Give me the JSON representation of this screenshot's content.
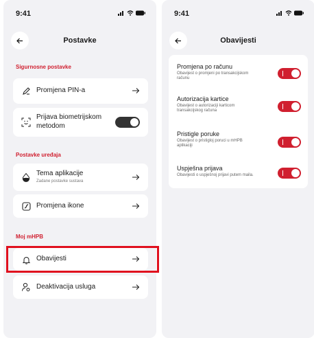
{
  "status": {
    "time": "9:41"
  },
  "settings": {
    "title": "Postavke",
    "sections": [
      {
        "title": "Sigurnosne postavke"
      },
      {
        "title": "Postavke uređaja"
      },
      {
        "title": "Moj mHPB"
      }
    ],
    "rows": {
      "pin": {
        "label": "Promjena PIN-a",
        "icon": "pencil-icon"
      },
      "biometric": {
        "label_line1": "Prijava biometrijskom",
        "label_line2": "metodom",
        "icon": "face-id-icon",
        "toggle": "off"
      },
      "theme": {
        "label": "Tema aplikacije",
        "sub": "Zadane postavke sustava",
        "icon": "theme-drop-icon"
      },
      "app_icon": {
        "label": "Promjena ikone",
        "icon": "app-icon-icon"
      },
      "notifications": {
        "label": "Obavijesti",
        "icon": "bell-icon",
        "highlighted": true
      },
      "deactivation": {
        "label": "Deaktivacija usluga",
        "icon": "user-settings-icon"
      }
    }
  },
  "notifications": {
    "title": "Obavijesti",
    "items": [
      {
        "title": "Promjena po računu",
        "desc": "Obavijest o promjeni po transakcijskom računu",
        "enabled": true
      },
      {
        "title": "Autorizacija kartice",
        "desc": "Obavijest o autorizaciji karticom transakcijskog računa",
        "enabled": true
      },
      {
        "title": "Pristigle poruke",
        "desc": "Obavijest o pristigloj poruci u mHPB aplikaciji",
        "enabled": true
      },
      {
        "title": "Uspješna prijava",
        "desc": "Obavijesti o uspješnoj prijavi putem maila.",
        "enabled": true
      }
    ]
  },
  "colors": {
    "accent": "#d01f2f",
    "highlight": "#e0101e",
    "background": "#f2f2f5"
  }
}
